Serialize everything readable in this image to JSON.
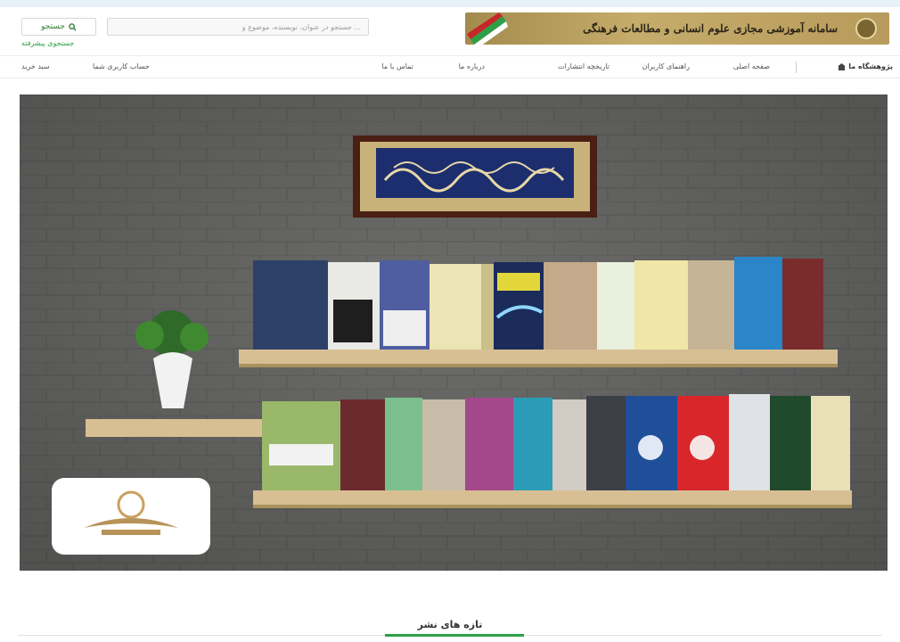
{
  "banner": {
    "title": "سامانه آموزشی مجازی علوم انسانی و مطالعات فرهنگی"
  },
  "search": {
    "placeholder": "جستجو در عنوان، نویسنده، موضوع و ...",
    "button_label": "جستجو",
    "advanced_label": "جستجوی پیشرفته"
  },
  "nav": {
    "items": [
      "پژوهشگاه ما",
      "صفحه اصلی",
      "راهنمای کاربران",
      "تاریخچه انتشارات",
      "درباره ما",
      "تماس با ما",
      "حساب کاربری شما",
      "سبد خرید"
    ]
  },
  "sections": {
    "new_publications": "تازه های نشر"
  },
  "colors": {
    "accent": "#2e9f46",
    "banner": "#b89b5c",
    "hero_wall": "#6e6e6c"
  }
}
